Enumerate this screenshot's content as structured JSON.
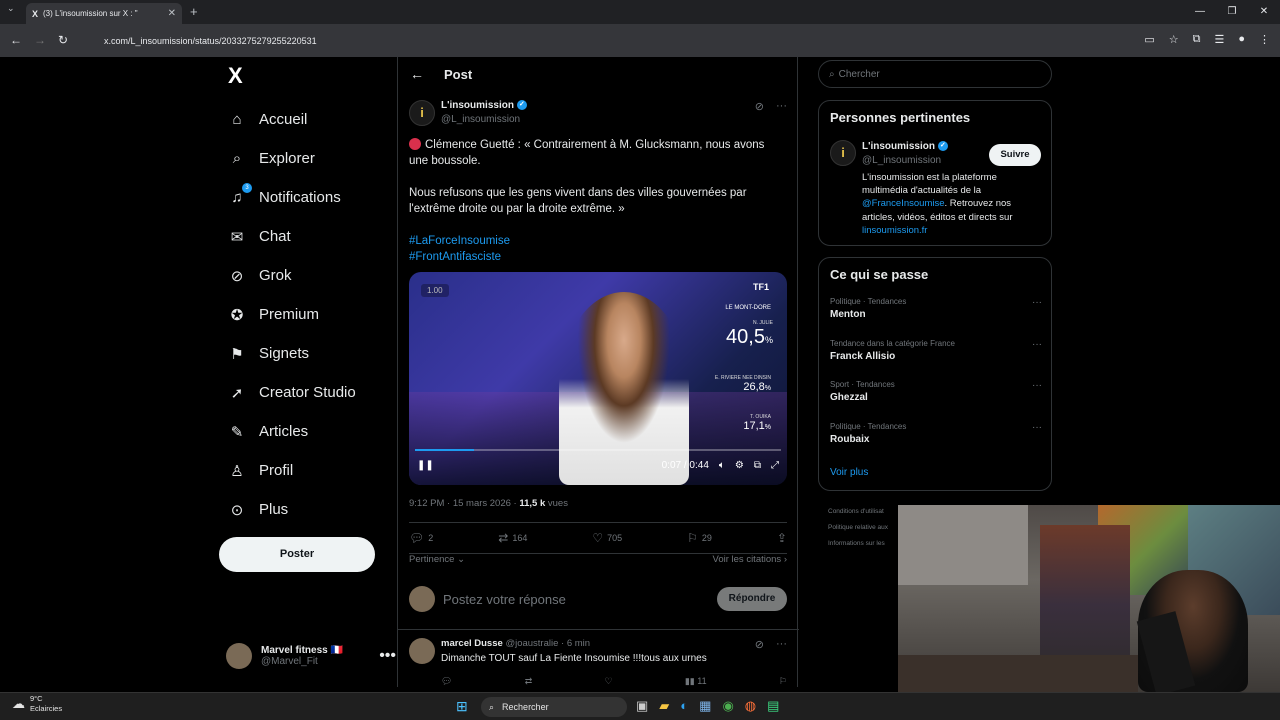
{
  "browser": {
    "tab_title": "(3) L'insoumission sur X : \"",
    "tab_logo": "X",
    "url": "x.com/L_insoumission/status/2033275279255220531"
  },
  "sidebar": {
    "logo": "X",
    "items": [
      {
        "label": "Accueil",
        "icon": "home-icon"
      },
      {
        "label": "Explorer",
        "icon": "search-icon"
      },
      {
        "label": "Notifications",
        "icon": "bell-icon",
        "badge": "3"
      },
      {
        "label": "Chat",
        "icon": "mail-icon"
      },
      {
        "label": "Grok",
        "icon": "grok-icon"
      },
      {
        "label": "Premium",
        "icon": "premium-icon"
      },
      {
        "label": "Signets",
        "icon": "bookmark-icon"
      },
      {
        "label": "Creator Studio",
        "icon": "rocket-icon"
      },
      {
        "label": "Articles",
        "icon": "article-icon"
      },
      {
        "label": "Profil",
        "icon": "person-icon"
      },
      {
        "label": "Plus",
        "icon": "more-circle-icon"
      }
    ],
    "post_button": "Poster",
    "account": {
      "name": "Marvel fitness 🇫🇷",
      "handle": "@Marvel_Fit"
    }
  },
  "main": {
    "header": "Post",
    "post": {
      "author": "L'insoumission",
      "handle": "@L_insoumission",
      "text1": "Clémence Guetté : « Contrairement à M. Glucksmann, nous avons une boussole.",
      "text2": "Nous refusons que les gens vivent dans des villes gouvernées par l'extrême droite ou par la droite extrême. »",
      "hashtag1": "#LaForceInsoumise",
      "hashtag2": "#FrontAntifasciste",
      "video": {
        "speed": "1.00",
        "channel": "TF1",
        "location": "LE MONT-DORE",
        "cand1": "N. JULIE",
        "score1": "40,5",
        "cand2": "E. RIVIERE NEE DINSIN",
        "score2": "26,8",
        "cand3": "T. OUIKA",
        "score3": "17,1",
        "time": "0:07 / 0:44",
        "progress": 0.16
      },
      "time": "9:12 PM · 15 mars 2026 · ",
      "views_count": "11,5 k",
      "views_label": " vues",
      "replies": "2",
      "reposts": "164",
      "likes": "705",
      "bookmarks": "29",
      "pertinence": "Pertinence",
      "citations": "Voir les citations"
    },
    "reply": {
      "placeholder": "Postez votre réponse",
      "button": "Répondre"
    },
    "comment": {
      "name": "marcel Dusse",
      "handle": "@joaustralie · 6 min",
      "text": "Dimanche TOUT sauf La Fiente Insoumise !!!tous aux urnes",
      "views": "11"
    }
  },
  "right": {
    "search_placeholder": "Chercher",
    "relevant_title": "Personnes pertinentes",
    "relevant": {
      "name": "L'insoumission",
      "handle": "@L_insoumission",
      "follow": "Suivre",
      "bio1": "L'insoumission est la plateforme multimédia d'actualités de la ",
      "bio_link": "@FranceInsoumise",
      "bio2": ". Retrouvez nos articles, vidéos, éditos et directs sur ",
      "bio_url": "linsoumission.fr"
    },
    "trends_title": "Ce qui se passe",
    "trends": [
      {
        "category": "Politique · Tendances",
        "title": "Menton"
      },
      {
        "category": "Tendance dans la catégorie France",
        "title": "Franck Allisio"
      },
      {
        "category": "Sport · Tendances",
        "title": "Ghezzal"
      },
      {
        "category": "Politique · Tendances",
        "title": "Roubaix"
      }
    ],
    "see_more": "Voir plus",
    "footer": [
      "Conditions d'utilisat",
      "Politique relative aux",
      "Informations sur les"
    ]
  },
  "taskbar": {
    "temp": "9°C",
    "weather": "Eclaircies",
    "search": "Rechercher"
  }
}
